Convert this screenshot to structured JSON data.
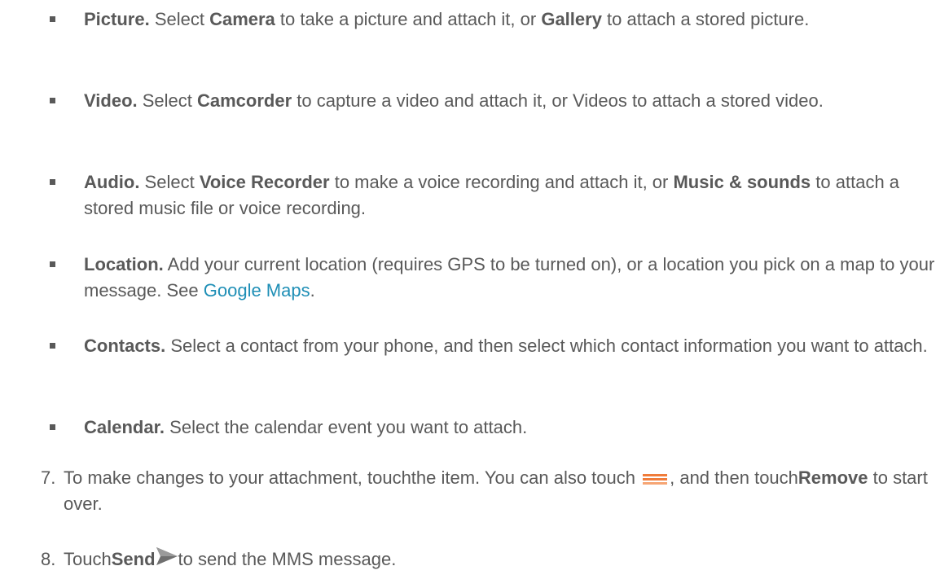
{
  "bullets": [
    {
      "title": "Picture.",
      "t1": " Select ",
      "b1": "Camera",
      "t2": " to take a picture and attach it, or ",
      "b2": "Gallery",
      "t3": " to attach a stored picture."
    },
    {
      "title": "Video.",
      "t1": " Select ",
      "b1": "Camcorder",
      "t2": " to capture a video and attach it, or Videos to attach a stored video."
    },
    {
      "title": "Audio.",
      "t1": " Select ",
      "b1": "Voice Recorder",
      "t2": " to make a voice recording and attach it, or ",
      "b2": "Music & sounds",
      "t3": " to attach a stored music file or voice recording."
    },
    {
      "title": "Location.",
      "t1": " Add your current location (requires GPS to be turned on), or a location you pick on a map to your message. See ",
      "link": "Google Maps",
      "t2": "."
    },
    {
      "title": "Contacts.",
      "t1": " Select a contact from your phone, and then select which contact information you want to attach."
    },
    {
      "title": "Calendar.",
      "t1": " Select the calendar event you want to attach."
    }
  ],
  "steps": [
    {
      "num": "7.",
      "t1": "To make changes to your attachment, touchthe item. You can also touch ",
      "icon": "menu-icon",
      "t2": ", and then touch",
      "b1": "Remove",
      "t3": " to start over."
    },
    {
      "num": "8.",
      "t1": "Touch",
      "b1": "Send",
      "icon": "send-icon",
      "t2": "to send the MMS message."
    }
  ],
  "colors": {
    "text": "#595959",
    "link": "#1f8fb6",
    "menu_icon": "#f07c3a",
    "send_icon": "#7a7a7a"
  }
}
